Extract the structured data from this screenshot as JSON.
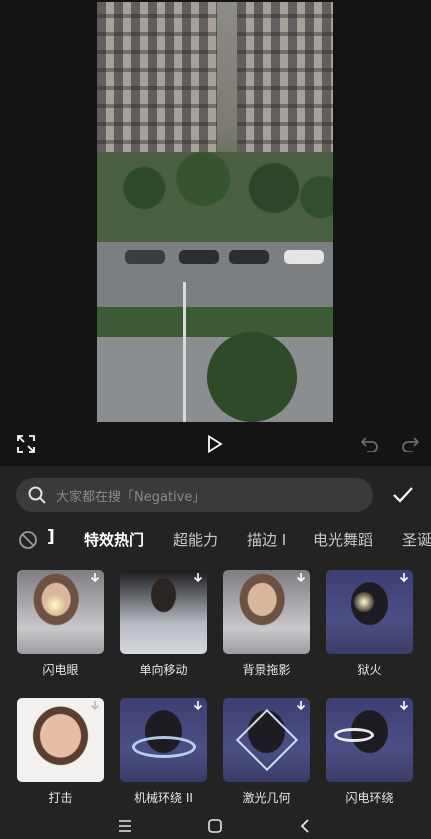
{
  "preview": {
    "controls": [
      "fullscreen-icon",
      "play-icon",
      "undo-icon",
      "redo-icon"
    ]
  },
  "panel": {
    "search_placeholder": "大家都在搜「Negative」",
    "tabs": [
      {
        "label": "特效热门",
        "active": true
      },
      {
        "label": "超能力",
        "active": false
      },
      {
        "label": "描边 I",
        "active": false
      },
      {
        "label": "电光舞蹈",
        "active": false
      },
      {
        "label": "圣诞",
        "active": false
      }
    ],
    "effects": [
      {
        "label": "闪电眼"
      },
      {
        "label": "单向移动"
      },
      {
        "label": "背景拖影"
      },
      {
        "label": "狱火"
      },
      {
        "label": "打击"
      },
      {
        "label": "机械环绕 II"
      },
      {
        "label": "激光几何"
      },
      {
        "label": "闪电环绕"
      }
    ]
  },
  "colors": {
    "panel_bg": "#232323",
    "search_bg": "#3a3a3a",
    "accent": "#ffffff"
  }
}
